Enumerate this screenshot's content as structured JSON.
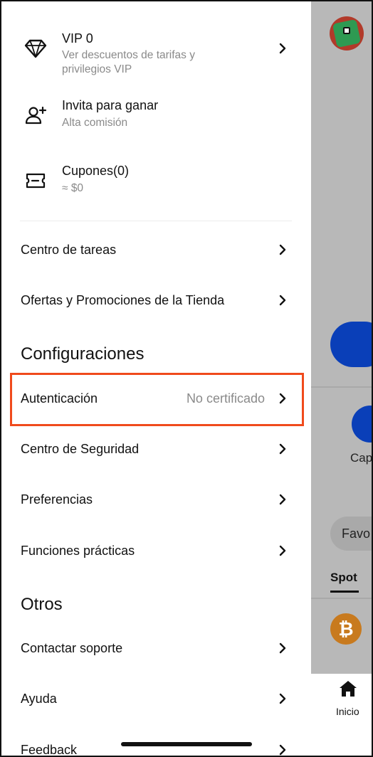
{
  "drawer": {
    "top_items": [
      {
        "title": "VIP 0",
        "subtitle": "Ver descuentos de tarifas y privilegios VIP",
        "icon": "diamond-icon"
      },
      {
        "title": "Invita para ganar",
        "subtitle": "Alta comisión",
        "icon": "add-user-icon"
      },
      {
        "title": "Cupones(0)",
        "subtitle": "≈ $0",
        "icon": "ticket-icon"
      }
    ],
    "links": [
      {
        "label": "Centro de tareas"
      },
      {
        "label": "Ofertas y Promociones de la Tienda"
      }
    ],
    "config_section": {
      "title": "Configuraciones",
      "items": [
        {
          "label": "Autenticación",
          "value": "No certificado"
        },
        {
          "label": "Centro de Seguridad"
        },
        {
          "label": "Preferencias"
        },
        {
          "label": "Funciones prácticas"
        }
      ]
    },
    "other_section": {
      "title": "Otros",
      "items": [
        {
          "label": "Contactar soporte"
        },
        {
          "label": "Ayuda"
        },
        {
          "label": "Feedback"
        }
      ]
    }
  },
  "background": {
    "partial_label": "Cap",
    "favorites_chip": "Favo",
    "spot_tab": "Spot",
    "coin_symbol": "₿",
    "tabbar_home": "Inicio"
  },
  "colors": {
    "highlight": "#f04a1c",
    "accent_blue": "#0a3fb8",
    "overlay": "#b8b8b8"
  }
}
